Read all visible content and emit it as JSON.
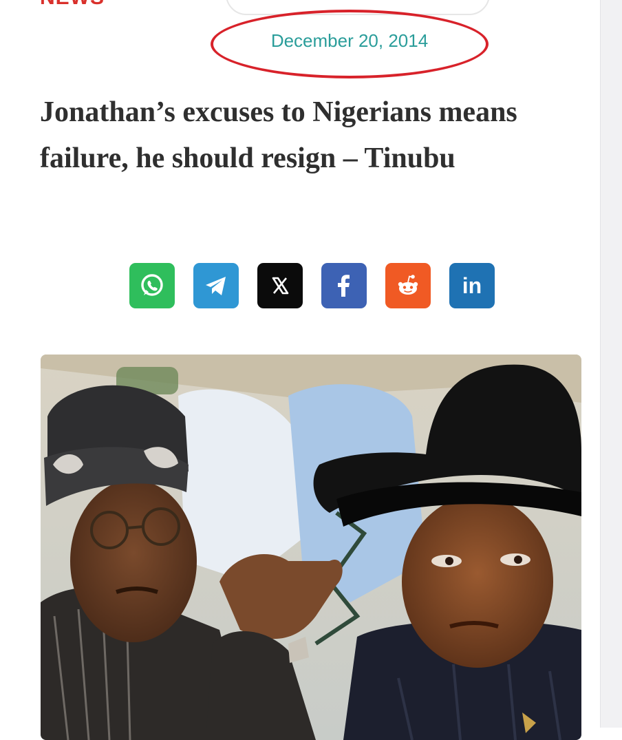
{
  "category": "NEWS",
  "date": "December 20, 2014",
  "headline": "Jonathan’s excuses to Nigerians means failure, he should resign – Tinubu",
  "colors": {
    "accent_red": "#d8222a",
    "date_teal": "#2a9d9a",
    "headline": "#2f2f2f"
  },
  "share_buttons": [
    {
      "network": "whatsapp",
      "icon": "whatsapp-icon",
      "color": "#2fbe5c"
    },
    {
      "network": "telegram",
      "icon": "telegram-icon",
      "color": "#2f97d4"
    },
    {
      "network": "x",
      "icon": "x-icon",
      "color": "#0b0b0b"
    },
    {
      "network": "facebook",
      "icon": "facebook-icon",
      "color": "#3d62b4"
    },
    {
      "network": "reddit",
      "icon": "reddit-icon",
      "color": "#f05a24"
    },
    {
      "network": "linkedin",
      "icon": "linkedin-icon",
      "color": "#1f72b3"
    }
  ]
}
